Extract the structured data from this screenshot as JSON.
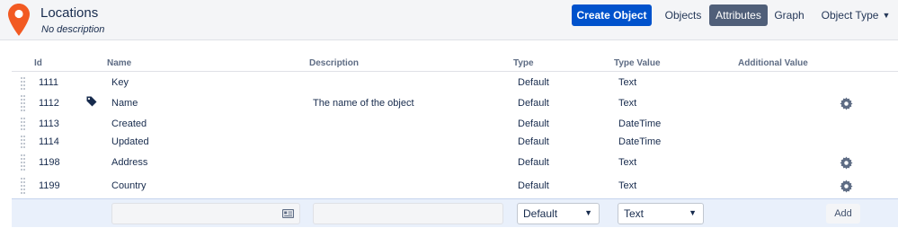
{
  "header": {
    "title": "Locations",
    "subtitle": "No description",
    "logo_icon": "map-pin-icon",
    "create_label": "Create Object",
    "nav": {
      "objects": "Objects",
      "attributes": "Attributes",
      "graph": "Graph",
      "object_type": "Object Type"
    },
    "accent_color": "#0052cc",
    "active_nav_color": "#505f79",
    "logo_color": "#f25a22"
  },
  "table": {
    "columns": [
      "Id",
      "Name",
      "Description",
      "Type",
      "Type Value",
      "Additional Value"
    ],
    "rows": [
      {
        "id": "1111",
        "name": "Key",
        "description": "",
        "type": "Default",
        "type_value": "Text",
        "label_icon": false,
        "settings_icon": false
      },
      {
        "id": "1112",
        "name": "Name",
        "description": "The name of the object",
        "type": "Default",
        "type_value": "Text",
        "label_icon": true,
        "settings_icon": true
      },
      {
        "id": "1113",
        "name": "Created",
        "description": "",
        "type": "Default",
        "type_value": "DateTime",
        "label_icon": false,
        "settings_icon": false
      },
      {
        "id": "1114",
        "name": "Updated",
        "description": "",
        "type": "Default",
        "type_value": "DateTime",
        "label_icon": false,
        "settings_icon": false
      },
      {
        "id": "1198",
        "name": "Address",
        "description": "",
        "type": "Default",
        "type_value": "Text",
        "label_icon": false,
        "settings_icon": true
      },
      {
        "id": "1199",
        "name": "Country",
        "description": "",
        "type": "Default",
        "type_value": "Text",
        "label_icon": false,
        "settings_icon": true
      }
    ]
  },
  "add_row": {
    "name_value": "",
    "description_value": "",
    "type_selected": "Default",
    "type_value_selected": "Text",
    "add_label": "Add"
  }
}
